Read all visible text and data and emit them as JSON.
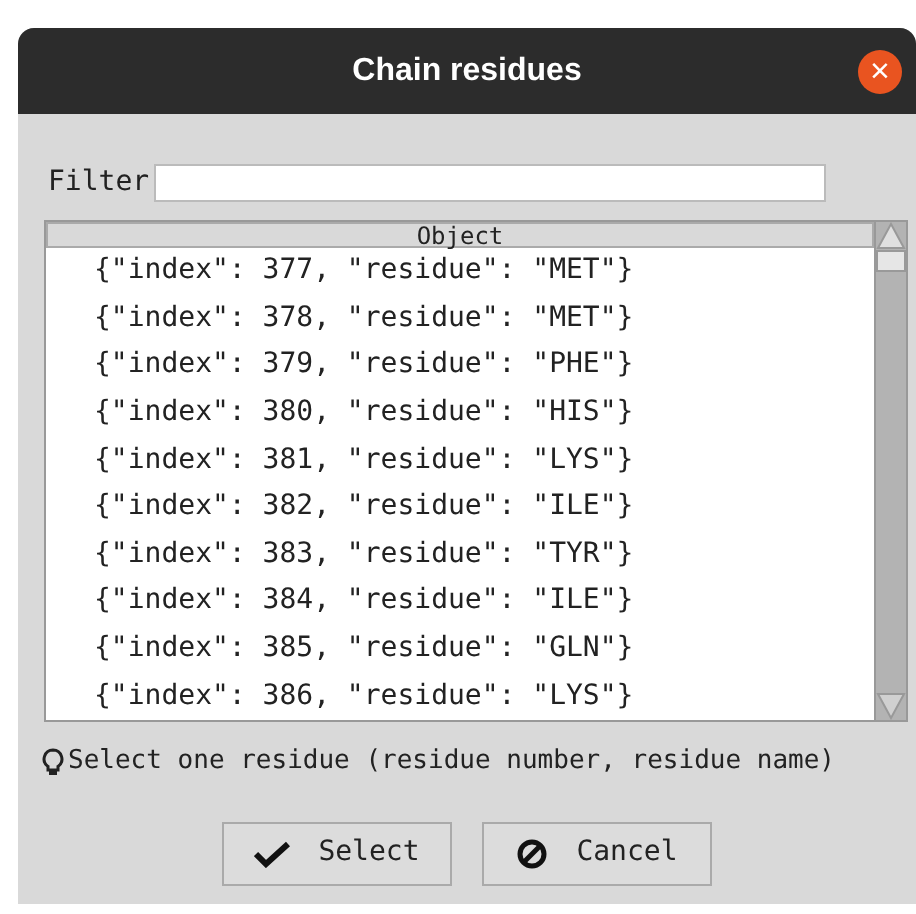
{
  "window": {
    "title": "Chain residues",
    "close": "×"
  },
  "filter": {
    "label": "Filter"
  },
  "table": {
    "columns": [
      "Object"
    ],
    "rows": [
      "{\"index\": 377, \"residue\": \"MET\"}",
      "{\"index\": 378, \"residue\": \"MET\"}",
      "{\"index\": 379, \"residue\": \"PHE\"}",
      "{\"index\": 380, \"residue\": \"HIS\"}",
      "{\"index\": 381, \"residue\": \"LYS\"}",
      "{\"index\": 382, \"residue\": \"ILE\"}",
      "{\"index\": 383, \"residue\": \"TYR\"}",
      "{\"index\": 384, \"residue\": \"ILE\"}",
      "{\"index\": 385, \"residue\": \"GLN\"}",
      "{\"index\": 386, \"residue\": \"LYS\"}"
    ]
  },
  "hint": "Select one residue (residue number, residue name)",
  "buttons": [
    {
      "kind": "select",
      "label": "Select"
    },
    {
      "kind": "cancel",
      "label": "Cancel"
    }
  ]
}
